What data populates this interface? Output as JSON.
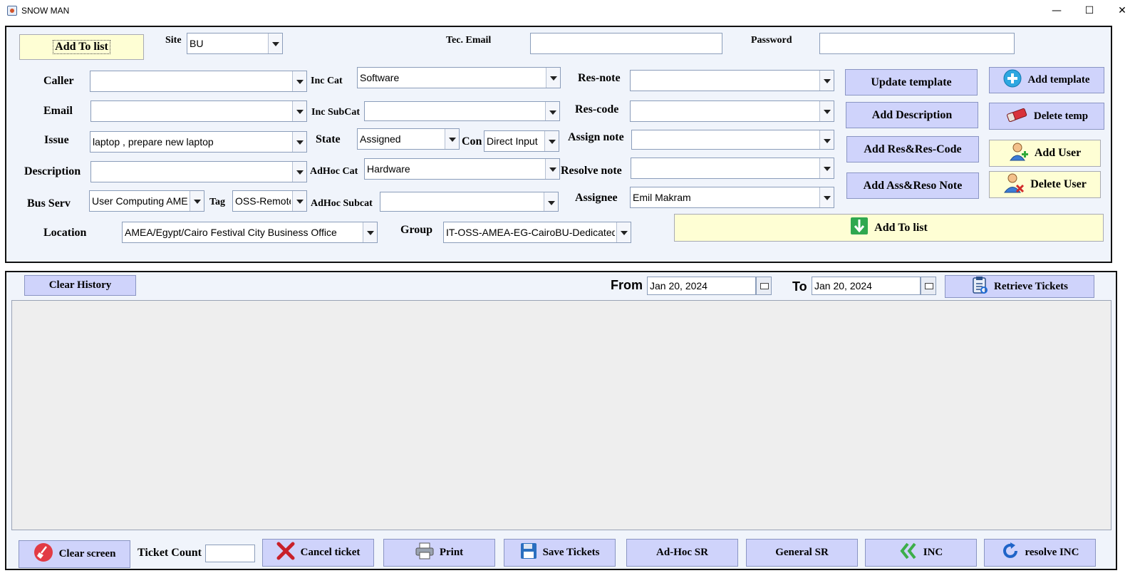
{
  "window": {
    "title": "SNOW MAN",
    "minimize": "—",
    "maximize": "☐",
    "close": "✕"
  },
  "form": {
    "add_to_list_top": "Add To list",
    "site": {
      "label": "Site",
      "value": "BU"
    },
    "tec_email": {
      "label": "Tec. Email",
      "value": ""
    },
    "password": {
      "label": "Password",
      "value": ""
    },
    "caller": {
      "label": "Caller",
      "value": ""
    },
    "email": {
      "label": "Email",
      "value": ""
    },
    "issue": {
      "label": "Issue",
      "value": "laptop , prepare new laptop"
    },
    "description": {
      "label": "Description",
      "value": ""
    },
    "bus_serv": {
      "label": "Bus Serv",
      "value": "User Computing AMEA"
    },
    "tag": {
      "label": "Tag",
      "value": "OSS-Remote"
    },
    "location": {
      "label": "Location",
      "value": "AMEA/Egypt/Cairo Festival City Business Office"
    },
    "inc_cat": {
      "label": "Inc Cat",
      "value": "Software"
    },
    "inc_subcat": {
      "label": "Inc SubCat",
      "value": ""
    },
    "state": {
      "label": "State",
      "value": "Assigned"
    },
    "con": {
      "label": "Con",
      "value": "Direct Input"
    },
    "adhoc_cat": {
      "label": "AdHoc Cat",
      "value": "Hardware"
    },
    "adhoc_subcat": {
      "label": "AdHoc Subcat",
      "value": ""
    },
    "group": {
      "label": "Group",
      "value": "IT-OSS-AMEA-EG-CairoBU-Dedicated"
    },
    "res_note": {
      "label": "Res-note",
      "value": ""
    },
    "res_code": {
      "label": "Res-code",
      "value": ""
    },
    "assign_note": {
      "label": "Assign note",
      "value": ""
    },
    "resolve_note": {
      "label": "Resolve note",
      "value": ""
    },
    "assignee": {
      "label": "Assignee",
      "value": "Emil Makram"
    },
    "buttons": {
      "update_template": "Update template",
      "add_description": "Add Description",
      "add_res_code": "Add Res&Res-Code",
      "add_ass_reso_note": "Add Ass&Reso Note",
      "add_template": "Add template",
      "delete_temp": "Delete temp",
      "add_user": "Add User",
      "delete_user": "Delete User",
      "add_to_list_bottom": "Add To list"
    }
  },
  "history": {
    "clear_history": "Clear History",
    "from_label": "From",
    "from_date": "Jan 20, 2024",
    "to_label": "To",
    "to_date": "Jan 20, 2024",
    "retrieve": "Retrieve Tickets"
  },
  "footer": {
    "clear_screen": "Clear screen",
    "ticket_count_label": "Ticket Count",
    "ticket_count_value": "",
    "cancel_ticket": "Cancel ticket",
    "print": "Print",
    "save_tickets": "Save Tickets",
    "adhoc_sr": "Ad-Hoc SR",
    "general_sr": "General SR",
    "inc": "INC",
    "resolve_inc": "resolve INC"
  },
  "colors": {
    "button": "#cfd3fb",
    "button_yellow": "#fefed4",
    "panel": "#f0f4fb",
    "grid": "#eeeeee"
  }
}
